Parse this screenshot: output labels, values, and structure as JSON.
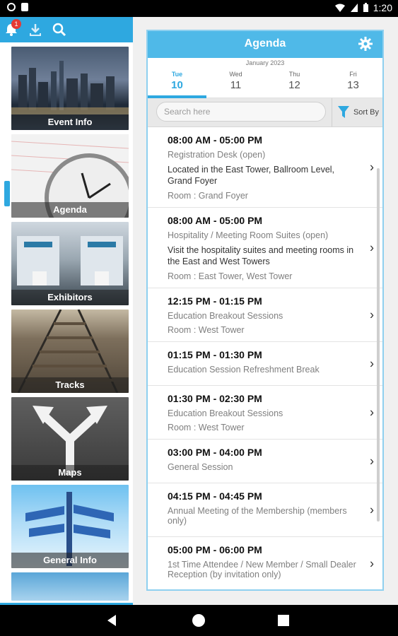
{
  "status": {
    "time": "1:20"
  },
  "notifications": {
    "badge_count": "1"
  },
  "tiles": [
    {
      "label": "Event Info"
    },
    {
      "label": "Agenda"
    },
    {
      "label": "Exhibitors"
    },
    {
      "label": "Tracks"
    },
    {
      "label": "Maps"
    },
    {
      "label": "General Info"
    }
  ],
  "agenda": {
    "title": "Agenda",
    "month": "January 2023",
    "days": [
      {
        "dow": "Tue",
        "num": "10"
      },
      {
        "dow": "Wed",
        "num": "11"
      },
      {
        "dow": "Thu",
        "num": "12"
      },
      {
        "dow": "Fri",
        "num": "13"
      }
    ],
    "search_placeholder": "Search here",
    "sort_label": "Sort By",
    "items": [
      {
        "time": "08:00 AM - 05:00 PM",
        "name": "Registration Desk (open)",
        "desc": "Located in the East Tower, Ballroom Level, Grand Foyer",
        "room": "Room : Grand Foyer"
      },
      {
        "time": "08:00 AM - 05:00 PM",
        "name": "Hospitality / Meeting Room Suites (open)",
        "desc": "Visit the hospitality suites and meeting rooms in the East and West Towers",
        "room": "Room : East Tower, West Tower"
      },
      {
        "time": "12:15 PM - 01:15 PM",
        "name": "Education Breakout Sessions",
        "desc": "",
        "room": "Room : West Tower"
      },
      {
        "time": "01:15 PM - 01:30 PM",
        "name": "Education Session Refreshment Break",
        "desc": "",
        "room": ""
      },
      {
        "time": "01:30 PM - 02:30 PM",
        "name": "Education Breakout Sessions",
        "desc": "",
        "room": "Room : West Tower"
      },
      {
        "time": "03:00 PM - 04:00 PM",
        "name": "General Session",
        "desc": "",
        "room": ""
      },
      {
        "time": "04:15 PM - 04:45 PM",
        "name": "Annual Meeting of the Membership (members only)",
        "desc": "",
        "room": ""
      },
      {
        "time": "05:00 PM - 06:00 PM",
        "name": "1st Time Attendee / New Member / Small Dealer Reception (by invitation only)",
        "desc": "",
        "room": ""
      }
    ]
  }
}
